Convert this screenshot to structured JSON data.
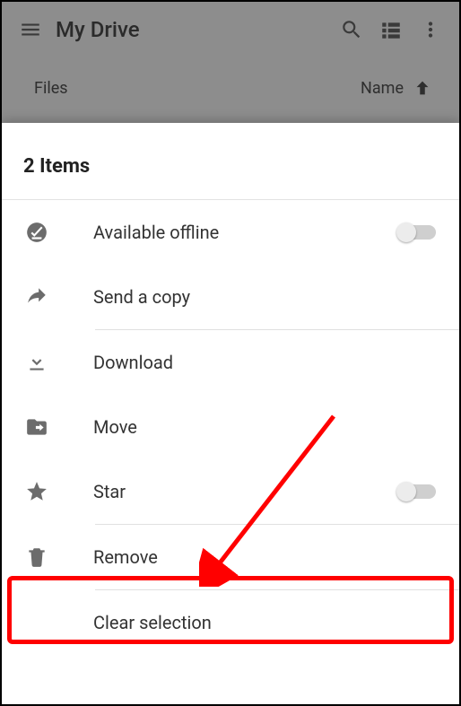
{
  "appbar": {
    "title": "My Drive"
  },
  "subheader": {
    "files_label": "Files",
    "sort_label": "Name"
  },
  "sheet": {
    "title": "2 Items",
    "available_offline": "Available offline",
    "send_copy": "Send a copy",
    "download": "Download",
    "move": "Move",
    "star": "Star",
    "remove": "Remove",
    "clear_selection": "Clear selection"
  },
  "toggles": {
    "available_offline": false,
    "star": false
  }
}
